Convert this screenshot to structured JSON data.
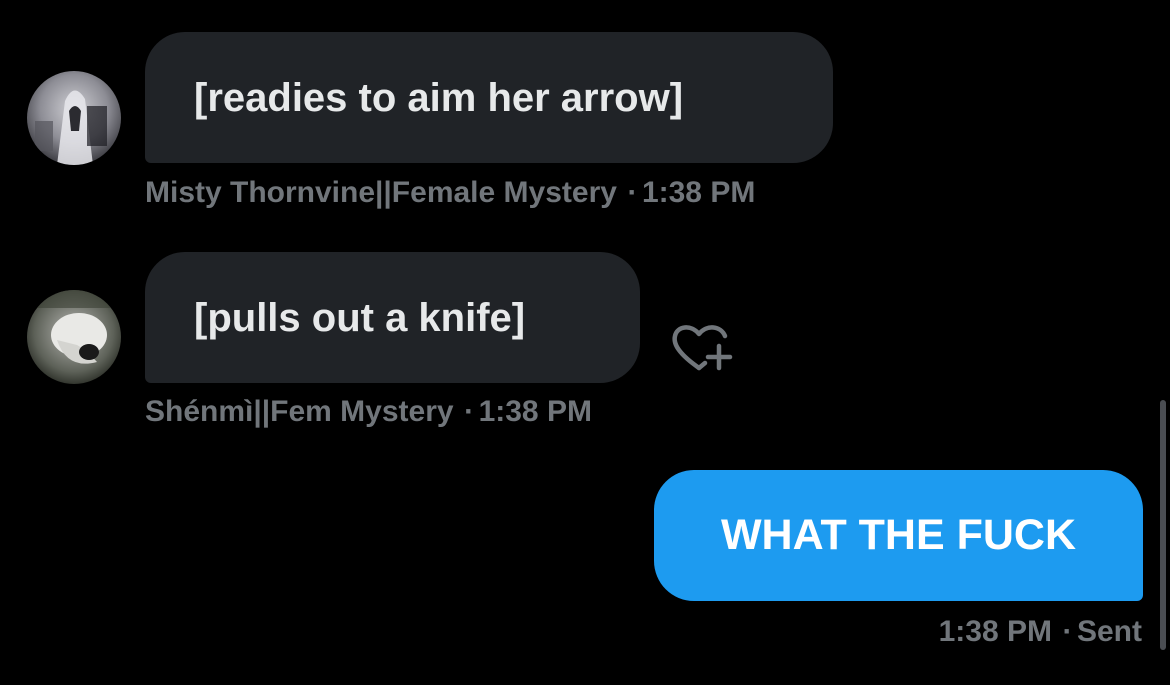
{
  "messages": [
    {
      "direction": "incoming",
      "text": "[readies to aim her arrow]",
      "sender": "Misty Thornvine||Female Mystery",
      "separator": "·",
      "time": "1:38 PM",
      "avatar": "sender-avatar-misty"
    },
    {
      "direction": "incoming",
      "text": "[pulls out a knife]",
      "sender": "Shénmì||Fem Mystery",
      "separator": "·",
      "time": "1:38 PM",
      "avatar": "sender-avatar-shenmi",
      "reaction_icon": "heart-plus-icon"
    },
    {
      "direction": "outgoing",
      "text": "WHAT THE FUCK",
      "time": "1:38 PM",
      "separator": "·",
      "status": "Sent"
    }
  ],
  "colors": {
    "background": "#000000",
    "incoming_bubble": "#202327",
    "outgoing_bubble": "#1d9bf0",
    "meta_text": "#71767b",
    "incoming_text": "#e7e9ea",
    "outgoing_text": "#ffffff"
  }
}
